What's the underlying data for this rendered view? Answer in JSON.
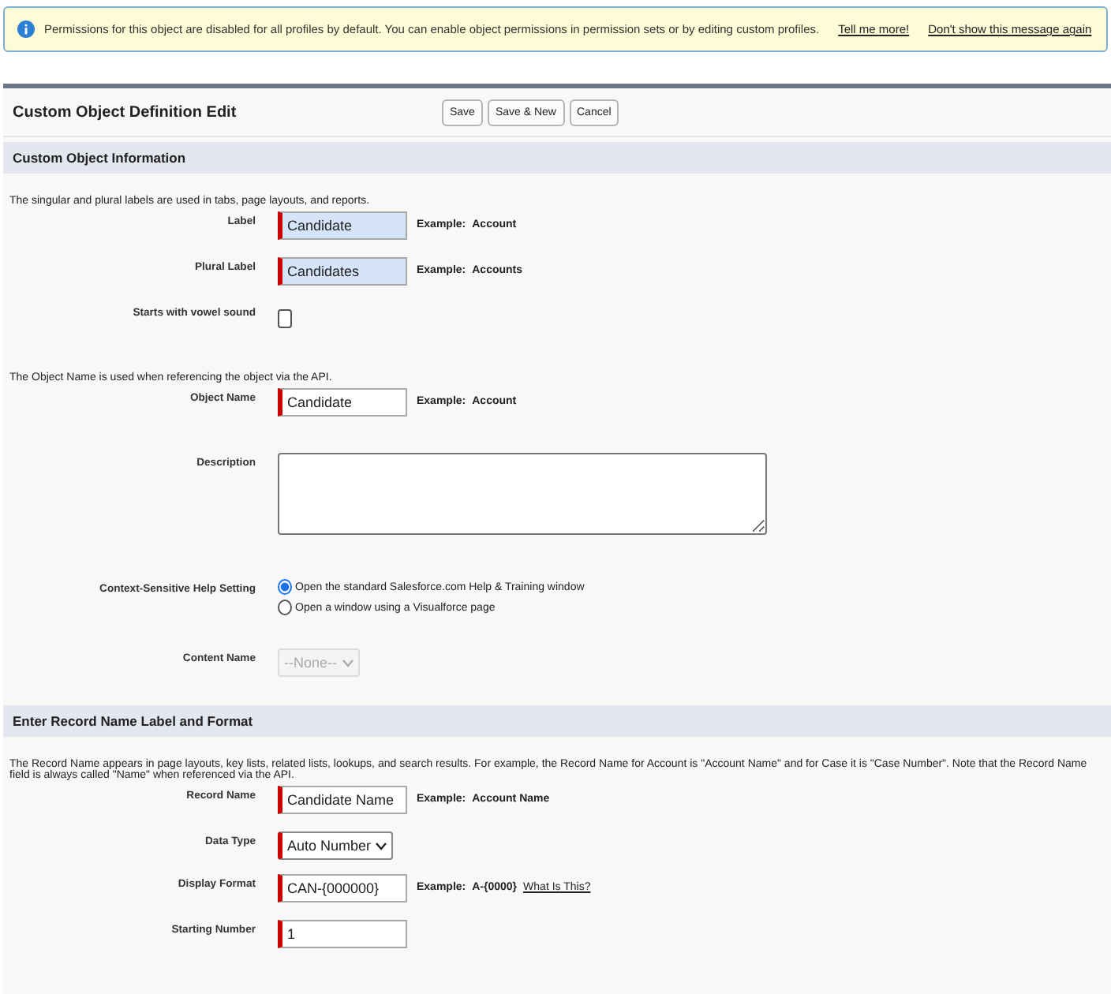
{
  "banner": {
    "text": "Permissions for this object are disabled for all profiles by default. You can enable object permissions in permission sets or by editing custom profiles.",
    "links": [
      "Tell me more!",
      "Don't show this message again"
    ]
  },
  "header": {
    "title": "Custom Object Definition Edit",
    "buttons": [
      "Save",
      "Save & New",
      "Cancel"
    ]
  },
  "sections": [
    {
      "title": "Custom Object Information",
      "rows": [
        {
          "kind": "note",
          "text": "The singular and plural labels are used in tabs, page layouts, and reports."
        },
        {
          "kind": "text",
          "label": "Label",
          "value": "Candidate",
          "required": true,
          "highlighted": true,
          "example": {
            "label": "Example:",
            "value": "Account"
          }
        },
        {
          "kind": "text",
          "label": "Plural Label",
          "value": "Candidates",
          "required": true,
          "highlighted": true,
          "example": {
            "label": "Example:",
            "value": "Accounts"
          }
        },
        {
          "kind": "checkbox",
          "label": "Starts with vowel sound",
          "checked": false
        },
        {
          "kind": "note",
          "text": "The Object Name is used when referencing the object via the API."
        },
        {
          "kind": "text",
          "label": "Object Name",
          "value": "Candidate",
          "required": true,
          "highlighted": false,
          "example": {
            "label": "Example:",
            "value": "Account"
          }
        },
        {
          "kind": "textarea",
          "label": "Description"
        },
        {
          "kind": "radio",
          "label": "Context-Sensitive Help Setting",
          "options": [
            {
              "label": "Open the standard Salesforce.com Help & Training window",
              "selected": true
            },
            {
              "label": "Open a window using a Visualforce page",
              "selected": false
            }
          ]
        },
        {
          "kind": "select",
          "label": "Content Name",
          "value": "--None--",
          "required": false,
          "disabled": true
        }
      ]
    },
    {
      "title": "Enter Record Name Label and Format",
      "rows": [
        {
          "kind": "note",
          "text": "The Record Name appears in page layouts, key lists, related lists, lookups, and search results. For example, the Record Name for Account is \"Account Name\" and for Case it is \"Case Number\". Note that the Record Name field is always called \"Name\" when referenced via the API."
        },
        {
          "kind": "text",
          "label": "Record Name",
          "value": "Candidate Name",
          "required": true,
          "highlighted": false,
          "example": {
            "label": "Example:",
            "value": "Account Name"
          }
        },
        {
          "kind": "select",
          "label": "Data Type",
          "value": "Auto Number",
          "required": true,
          "disabled": false
        },
        {
          "kind": "text",
          "label": "Display Format",
          "value": "CAN-{000000}",
          "required": true,
          "highlighted": false,
          "example": {
            "label": "Example:",
            "value": "A-{0000}",
            "link": "What Is This?"
          }
        },
        {
          "kind": "text",
          "label": "Starting Number",
          "value": "1",
          "required": true,
          "highlighted": false
        }
      ]
    }
  ]
}
